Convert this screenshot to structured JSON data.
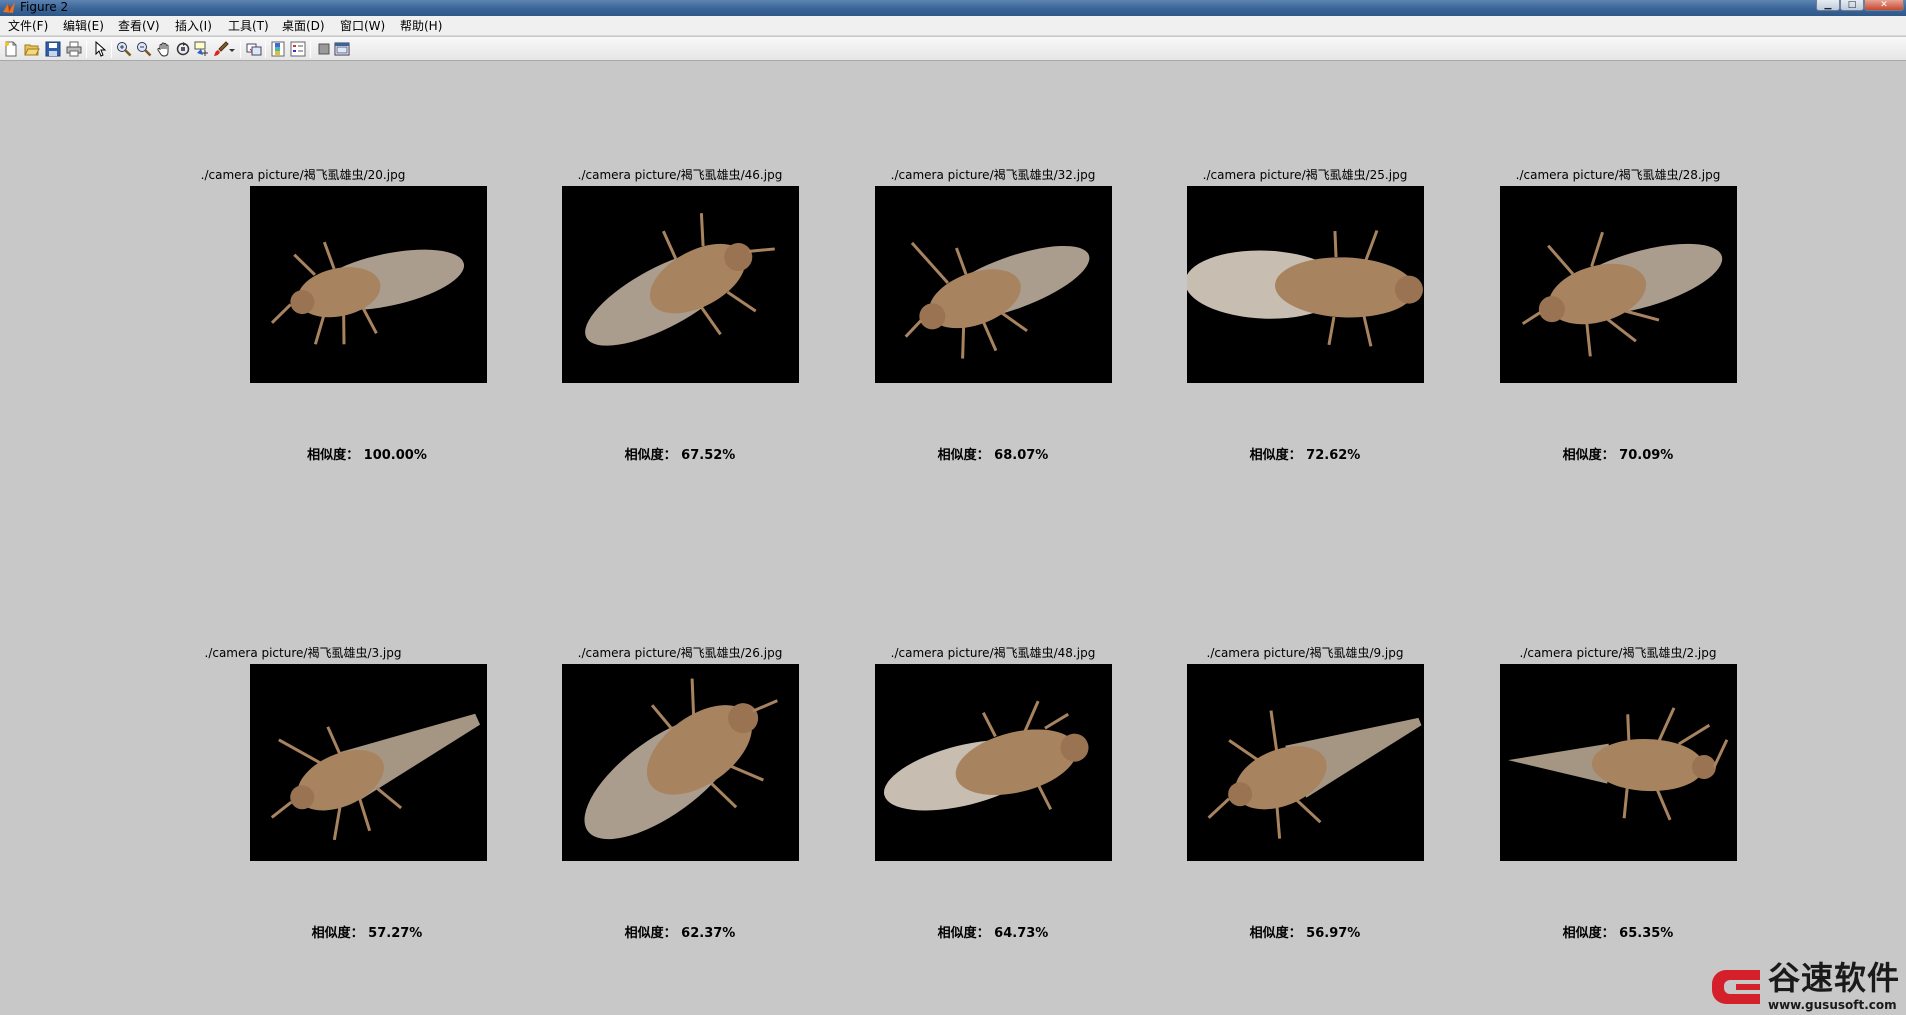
{
  "window": {
    "title": "Figure 2",
    "controls": {
      "minimize": "▁",
      "maximize": "□",
      "close": "✕"
    }
  },
  "menubar": {
    "items": [
      "文件(F)",
      "编辑(E)",
      "查看(V)",
      "插入(I)",
      "工具(T)",
      "桌面(D)",
      "窗口(W)",
      "帮助(H)"
    ]
  },
  "toolbar": {
    "buttons": [
      "new-figure-icon",
      "open-file-icon",
      "save-icon",
      "print-icon",
      "edit-plot-arrow-icon",
      "zoom-in-icon",
      "zoom-out-icon",
      "pan-hand-icon",
      "rotate-3d-icon",
      "data-cursor-icon",
      "brush-icon",
      "brush-dropdown-icon",
      "link-plot-icon",
      "insert-colorbar-icon",
      "insert-legend-icon",
      "hide-plot-tools-icon",
      "show-plot-tools-icon"
    ]
  },
  "colors": {
    "canvas_background": "#c8c8c8",
    "image_background": "#000000",
    "insect_body": "#a8835f",
    "insect_wing": "#c9b9a6",
    "logo_red": "#d4202a"
  },
  "results": [
    {
      "path": "./camera picture/褐飞虱雄虫/20.jpg",
      "similarity": "相似度： 100.00%"
    },
    {
      "path": "./camera picture/褐飞虱雄虫/46.jpg",
      "similarity": "相似度： 67.52%"
    },
    {
      "path": "./camera picture/褐飞虱雄虫/32.jpg",
      "similarity": "相似度： 68.07%"
    },
    {
      "path": "./camera picture/褐飞虱雄虫/25.jpg",
      "similarity": "相似度： 72.62%"
    },
    {
      "path": "./camera picture/褐飞虱雄虫/28.jpg",
      "similarity": "相似度： 70.09%"
    },
    {
      "path": "./camera picture/褐飞虱雄虫/3.jpg",
      "similarity": "相似度： 57.27%"
    },
    {
      "path": "./camera picture/褐飞虱雄虫/26.jpg",
      "similarity": "相似度： 62.37%"
    },
    {
      "path": "./camera picture/褐飞虱雄虫/48.jpg",
      "similarity": "相似度： 64.73%"
    },
    {
      "path": "./camera picture/褐飞虱雄虫/9.jpg",
      "similarity": "相似度： 56.97%"
    },
    {
      "path": "./camera picture/褐飞虱雄虫/2.jpg",
      "similarity": "相似度： 65.35%"
    }
  ],
  "watermark": {
    "brand": "谷速软件",
    "url": "www.gususoft.com"
  }
}
